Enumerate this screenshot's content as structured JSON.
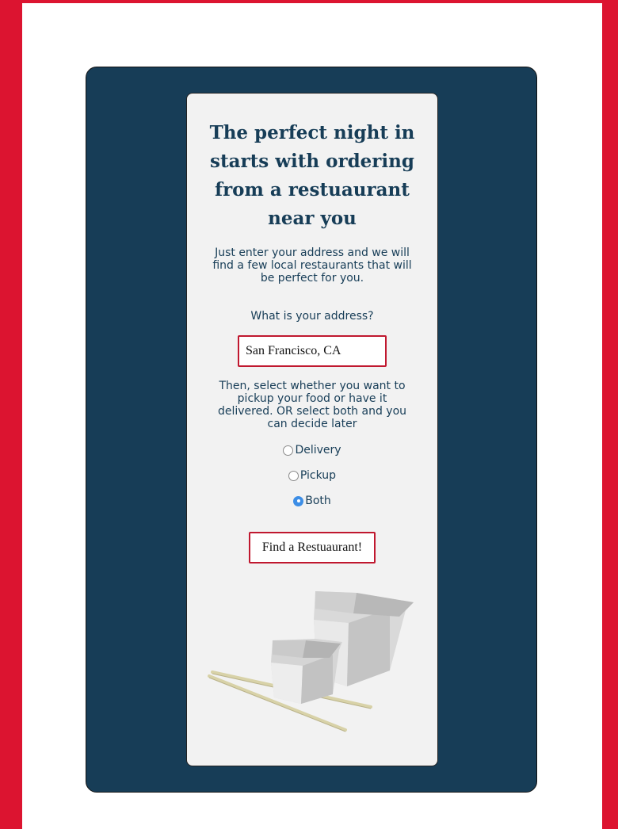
{
  "hero": {
    "title": "The perfect night in starts with ordering from a restuaurant near you",
    "intro": "Just enter your address and we will find a few local restaurants that will be perfect for you."
  },
  "form": {
    "address_label": "What is your address?",
    "address_value": "San Francisco, CA",
    "instructions": "Then, select whether you want to pickup your food or have it delivered. OR select both and you can decide later",
    "options": [
      {
        "label": "Delivery",
        "checked": false
      },
      {
        "label": "Pickup",
        "checked": false
      },
      {
        "label": "Both",
        "checked": true
      }
    ],
    "submit_label": "Find a Restuaurant!"
  },
  "colors": {
    "page_border": "#dc1430",
    "panel": "#173d57",
    "card": "#f2f2f2",
    "accent": "#c0182f",
    "radio_checked": "#3d8ee6"
  },
  "image": {
    "icon": "takeout-boxes-chopsticks-image"
  }
}
